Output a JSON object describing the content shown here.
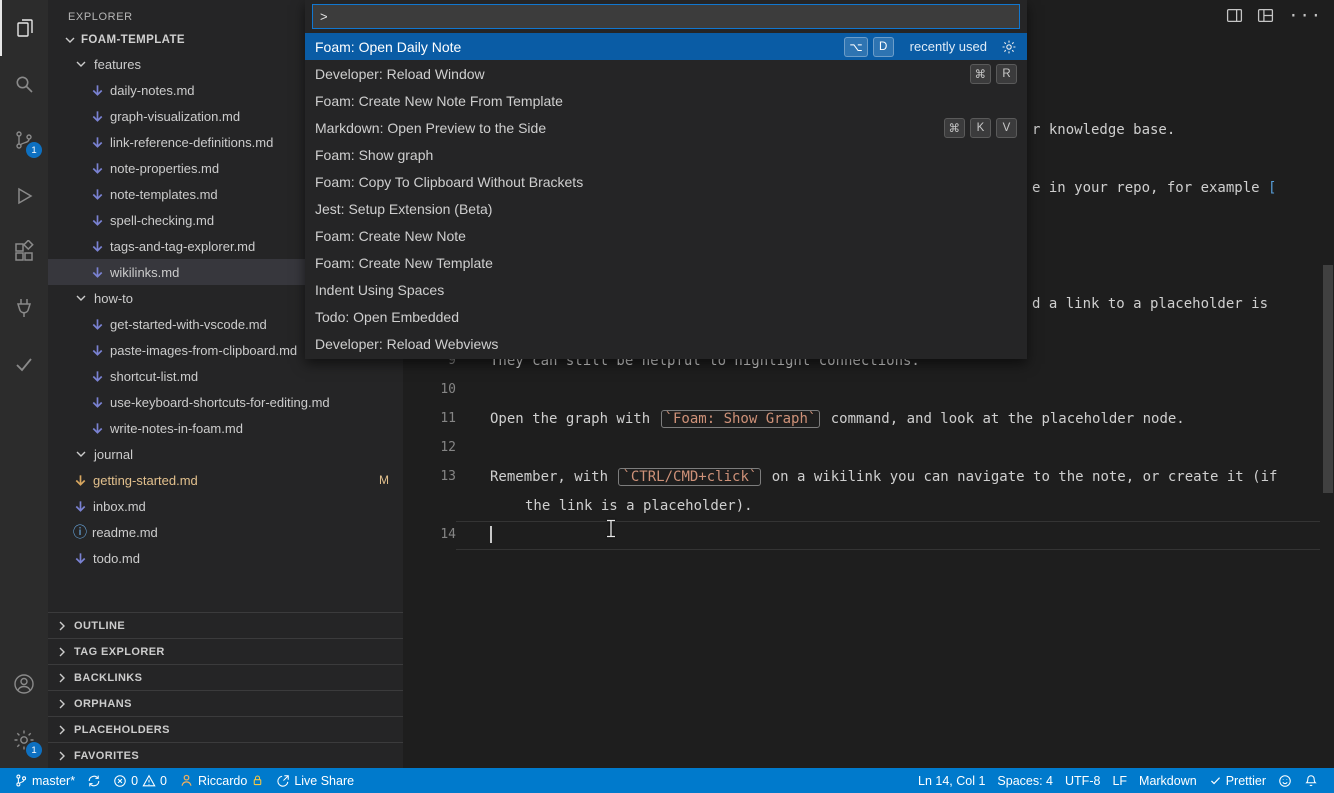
{
  "sidebar": {
    "title": "EXPLORER",
    "workspace": "FOAM-TEMPLATE",
    "tree": [
      {
        "label": "features",
        "type": "folder",
        "level": 1,
        "expanded": true
      },
      {
        "label": "daily-notes.md",
        "type": "file",
        "icon": "arrow",
        "level": 2
      },
      {
        "label": "graph-visualization.md",
        "type": "file",
        "icon": "arrow",
        "level": 2
      },
      {
        "label": "link-reference-definitions.md",
        "type": "file",
        "icon": "arrow",
        "level": 2
      },
      {
        "label": "note-properties.md",
        "type": "file",
        "icon": "arrow",
        "level": 2
      },
      {
        "label": "note-templates.md",
        "type": "file",
        "icon": "arrow",
        "level": 2
      },
      {
        "label": "spell-checking.md",
        "type": "file",
        "icon": "arrow",
        "level": 2
      },
      {
        "label": "tags-and-tag-explorer.md",
        "type": "file",
        "icon": "arrow",
        "level": 2
      },
      {
        "label": "wikilinks.md",
        "type": "file",
        "icon": "arrow",
        "level": 2,
        "selected": true
      },
      {
        "label": "how-to",
        "type": "folder",
        "level": 1,
        "expanded": true
      },
      {
        "label": "get-started-with-vscode.md",
        "type": "file",
        "icon": "arrow",
        "level": 2
      },
      {
        "label": "paste-images-from-clipboard.md",
        "type": "file",
        "icon": "arrow",
        "level": 2
      },
      {
        "label": "shortcut-list.md",
        "type": "file",
        "icon": "arrow",
        "level": 2
      },
      {
        "label": "use-keyboard-shortcuts-for-editing.md",
        "type": "file",
        "icon": "arrow",
        "level": 2
      },
      {
        "label": "write-notes-in-foam.md",
        "type": "file",
        "icon": "arrow",
        "level": 2
      },
      {
        "label": "journal",
        "type": "folder",
        "level": 1,
        "expanded": true
      },
      {
        "label": "getting-started.md",
        "type": "file",
        "icon": "arrow",
        "level": 1,
        "modified": true,
        "badge": "M"
      },
      {
        "label": "inbox.md",
        "type": "file",
        "icon": "arrow",
        "level": 1
      },
      {
        "label": "readme.md",
        "type": "file",
        "icon": "info",
        "level": 1
      },
      {
        "label": "todo.md",
        "type": "file",
        "icon": "arrow",
        "level": 1
      }
    ],
    "sections": [
      "OUTLINE",
      "TAG EXPLORER",
      "BACKLINKS",
      "ORPHANS",
      "PLACEHOLDERS",
      "FAVORITES"
    ]
  },
  "activity_bar": {
    "source_control_badge": "1",
    "settings_badge": "1"
  },
  "palette": {
    "query": ">",
    "items": [
      {
        "label": "Foam: Open Daily Note",
        "keys": [
          "⌥",
          "D"
        ],
        "note": "recently used",
        "focused": true,
        "gear": true
      },
      {
        "label": "Developer: Reload Window",
        "keys": [
          "⌘",
          "R"
        ]
      },
      {
        "label": "Foam: Create New Note From Template",
        "keys": []
      },
      {
        "label": "Markdown: Open Preview to the Side",
        "keys": [
          "⌘",
          "K",
          "V"
        ]
      },
      {
        "label": "Foam: Show graph",
        "keys": []
      },
      {
        "label": "Foam: Copy To Clipboard Without Brackets",
        "keys": []
      },
      {
        "label": "Jest: Setup Extension (Beta)",
        "keys": []
      },
      {
        "label": "Foam: Create New Note",
        "keys": []
      },
      {
        "label": "Foam: Create New Template",
        "keys": []
      },
      {
        "label": "Indent Using Spaces",
        "keys": []
      },
      {
        "label": "Todo: Open Embedded",
        "keys": []
      },
      {
        "label": "Developer: Reload Webviews",
        "keys": []
      }
    ]
  },
  "editor": {
    "fragments": [
      {
        "segments": [
          {
            "t": "r knowledge base.",
            "c": "plain"
          }
        ]
      },
      {
        "segments": [
          {
            "t": "e in your repo, for example ",
            "c": "plain"
          },
          {
            "t": "[",
            "c": "bracket"
          }
        ]
      },
      {
        "segments": [
          {
            "t": "d a link to a placeholder is",
            "c": "plain"
          }
        ]
      }
    ],
    "lines": [
      {
        "num": "9",
        "segments": [
          {
            "t": "They can still be helpful to highlight connections.",
            "c": "plain"
          }
        ]
      },
      {
        "num": "10",
        "segments": []
      },
      {
        "num": "11",
        "segments": [
          {
            "t": "Open the graph with ",
            "c": "plain"
          },
          {
            "t": "`Foam: Show Graph`",
            "c": "code"
          },
          {
            "t": " command, and look at the placeholder node.",
            "c": "plain"
          }
        ]
      },
      {
        "num": "12",
        "segments": []
      },
      {
        "num": "13",
        "segments": [
          {
            "t": "Remember, with ",
            "c": "plain"
          },
          {
            "t": "`CTRL/CMD+click`",
            "c": "code"
          },
          {
            "t": " on a wikilink you can navigate to the note, or create it (if",
            "c": "plain"
          }
        ]
      },
      {
        "num": "",
        "wrap": true,
        "segments": [
          {
            "t": "the link is a placeholder).",
            "c": "plain"
          }
        ]
      },
      {
        "num": "14",
        "current": true,
        "segments": []
      }
    ]
  },
  "status_bar": {
    "branch": "master*",
    "errors": "0",
    "warnings": "0",
    "user": "Riccardo",
    "live_share": "Live Share",
    "cursor": "Ln 14, Col 1",
    "indent": "Spaces: 4",
    "encoding": "UTF-8",
    "eol": "LF",
    "language": "Markdown",
    "formatter": "Prettier"
  },
  "colors": {
    "accent": "#007acc",
    "selection_blue": "#0a5ca5",
    "modified_orange": "#e2c08d",
    "inline_code": "#ce9178"
  }
}
